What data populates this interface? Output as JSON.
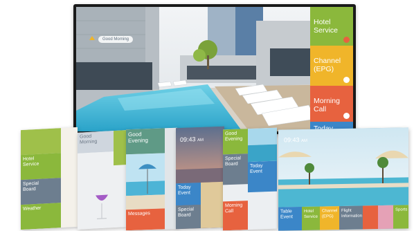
{
  "tv": {
    "greeting": "Good Morning",
    "menu": [
      {
        "label": "Hotel\nService",
        "color": "#8bb83c",
        "icon": "person-icon"
      },
      {
        "label": "Channel\n(EPG)",
        "color": "#f0b52a",
        "icon": "tv-icon"
      },
      {
        "label": "Morning\nCall",
        "color": "#e7623f",
        "icon": "clock-icon"
      },
      {
        "label": "Today",
        "color": "#3b86c8",
        "icon": ""
      }
    ]
  },
  "panels": {
    "p1": {
      "tiles": [
        {
          "label": "Hotel\nService",
          "color": "#8bb83c"
        },
        {
          "label": "Special\nBoard",
          "color": "#6d7e8f"
        },
        {
          "label": "Weather",
          "color": "#8bb83c"
        }
      ]
    },
    "p2": {
      "greeting": "Good\nMorning"
    },
    "p3": {
      "greeting": "Good\nEvening",
      "tiles": [
        {
          "label": "Messages",
          "color": "#e7623f"
        }
      ]
    },
    "p4": {
      "time": "09:43",
      "ampm": "AM",
      "tiles": [
        {
          "label": "Today\nEvent",
          "color": "#3b86c8"
        },
        {
          "label": "Special\nBoard",
          "color": "#6d7e8f"
        }
      ]
    },
    "p5": {
      "greeting": "Good\nEvening",
      "tiles": [
        {
          "label": "Special\nBoard",
          "color": "#6d7e8f"
        },
        {
          "label": "Today\nEvent",
          "color": "#3b86c8"
        },
        {
          "label": "Morning\nCall",
          "color": "#e7623f"
        }
      ]
    },
    "p6": {
      "time": "09:43",
      "ampm": "AM",
      "tiles": [
        {
          "label": "Table\nEvent",
          "color": "#3b86c8"
        },
        {
          "label": "Hotel\nService",
          "color": "#8bb83c"
        },
        {
          "label": "Channel\n(EPG)",
          "color": "#f0b52a"
        },
        {
          "label": "Flight\nInformation",
          "color": "#6d7e8f"
        },
        {
          "label": "",
          "color": "#e7623f"
        },
        {
          "label": "",
          "color": "#e5a1b6"
        },
        {
          "label": "Sports",
          "color": "#8bb83c"
        }
      ]
    }
  }
}
